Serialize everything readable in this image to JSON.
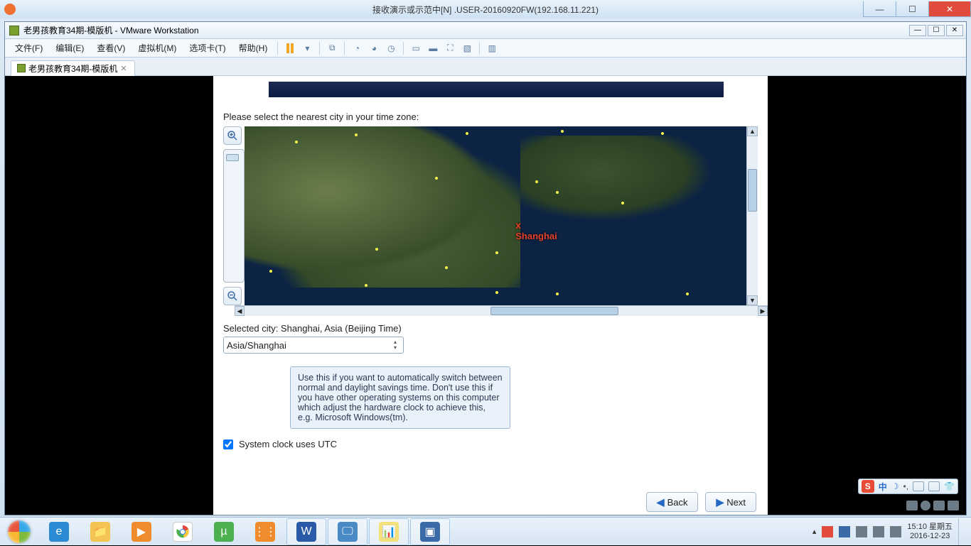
{
  "outer": {
    "title": "接收演示或示范中[N] .USER-20160920FW(192.168.11.221)"
  },
  "vmw": {
    "title": "老男孩教育34期-模版机 - VMware Workstation",
    "menus": [
      "文件(F)",
      "编辑(E)",
      "查看(V)",
      "虚拟机(M)",
      "选项卡(T)",
      "帮助(H)"
    ],
    "tab": "老男孩教育34期-模版机"
  },
  "installer": {
    "prompt": "Please select the nearest city in your time zone:",
    "marker_label": "Shanghai",
    "selected_city_label": "Selected city: Shanghai, Asia (Beijing Time)",
    "tz_value": "Asia/Shanghai",
    "tooltip": "Use this if you want to automatically switch between normal and daylight savings time. Don't use this if you have other operating systems on this computer which adjust the hardware clock to achieve this, e.g. Microsoft Windows(tm).",
    "utc_label": "System clock uses UTC",
    "back": "Back",
    "next": "Next"
  },
  "ime": {
    "zh": "中"
  },
  "tray": {
    "time": "15:10",
    "weekday": "星期五",
    "date": "2016-12-23"
  }
}
